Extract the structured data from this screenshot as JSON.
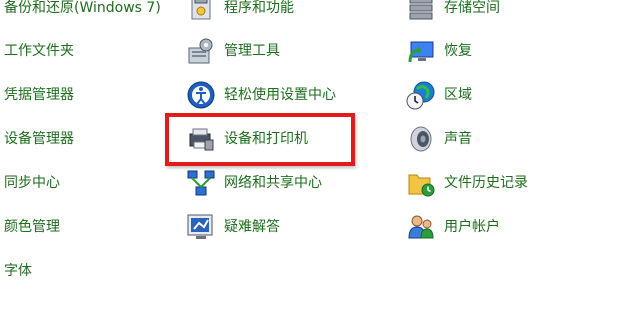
{
  "colors": {
    "link_text": "#1e6e1e",
    "highlight_border": "#e21b1b",
    "background": "#ffffff"
  },
  "left_column": [
    {
      "label": "备份和还原(Windows 7)"
    },
    {
      "label": "工作文件夹"
    },
    {
      "label": "凭据管理器"
    },
    {
      "label": "设备管理器"
    },
    {
      "label": "同步中心"
    },
    {
      "label": "颜色管理"
    },
    {
      "label": "字体"
    }
  ],
  "middle_column": [
    {
      "label": "程序和功能",
      "icon": "programs-features-icon"
    },
    {
      "label": "管理工具",
      "icon": "admin-tools-icon"
    },
    {
      "label": "轻松使用设置中心",
      "icon": "ease-of-access-icon"
    },
    {
      "label": "设备和打印机",
      "icon": "printer-icon"
    },
    {
      "label": "网络和共享中心",
      "icon": "network-icon"
    },
    {
      "label": "疑难解答",
      "icon": "troubleshoot-icon"
    }
  ],
  "right_column": [
    {
      "label": "存储空间",
      "icon": "storage-icon"
    },
    {
      "label": "恢复",
      "icon": "recovery-icon"
    },
    {
      "label": "区域",
      "icon": "region-clock-icon"
    },
    {
      "label": "声音",
      "icon": "speaker-icon"
    },
    {
      "label": "文件历史记录",
      "icon": "file-history-icon"
    },
    {
      "label": "用户帐户",
      "icon": "user-accounts-icon"
    }
  ]
}
